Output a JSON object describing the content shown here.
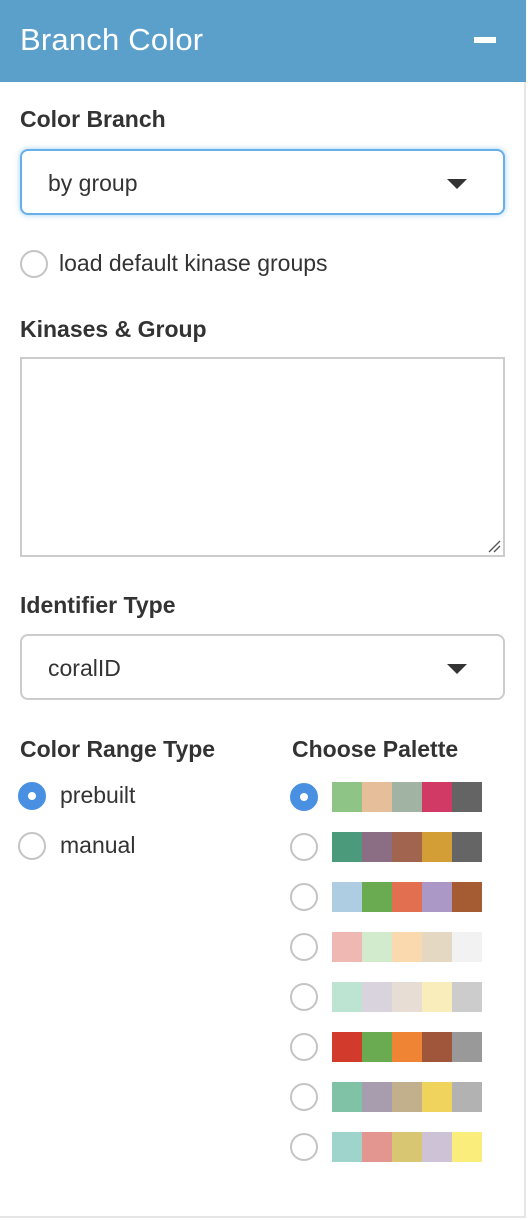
{
  "header": {
    "title": "Branch Color",
    "collapse_icon": "minus-icon"
  },
  "color_branch": {
    "label": "Color Branch",
    "value": "by group"
  },
  "load_default": {
    "label": "load default kinase groups",
    "checked": false
  },
  "kinases_group": {
    "label": "Kinases & Group",
    "value": ""
  },
  "identifier_type": {
    "label": "Identifier Type",
    "value": "coralID"
  },
  "color_range_type": {
    "label": "Color Range Type",
    "options": [
      {
        "label": "prebuilt",
        "checked": true
      },
      {
        "label": "manual",
        "checked": false
      }
    ]
  },
  "choose_palette": {
    "label": "Choose Palette",
    "selected_index": 0,
    "palettes": [
      [
        "#8ec587",
        "#e6bf9a",
        "#a1b4a4",
        "#d13a64",
        "#646464"
      ],
      [
        "#4c9a7c",
        "#8b6d84",
        "#a0644f",
        "#d29e35",
        "#656565"
      ],
      [
        "#aecde3",
        "#6aab51",
        "#e26f4f",
        "#ac98c7",
        "#a65c32"
      ],
      [
        "#efb8b2",
        "#d3ebcd",
        "#f9d9ad",
        "#e4d8c3",
        "#f2f2f2"
      ],
      [
        "#bde3d2",
        "#d9d3de",
        "#e8ddd5",
        "#f9edbc",
        "#cccccc"
      ],
      [
        "#d23a2c",
        "#6aab51",
        "#ef8434",
        "#a0563a",
        "#999999"
      ],
      [
        "#80c2a6",
        "#a89caf",
        "#c2af8b",
        "#f0d35d",
        "#b2b2b2"
      ],
      [
        "#9fd4cc",
        "#e39690",
        "#d8c673",
        "#cec3d6",
        "#fbed7c"
      ]
    ]
  }
}
